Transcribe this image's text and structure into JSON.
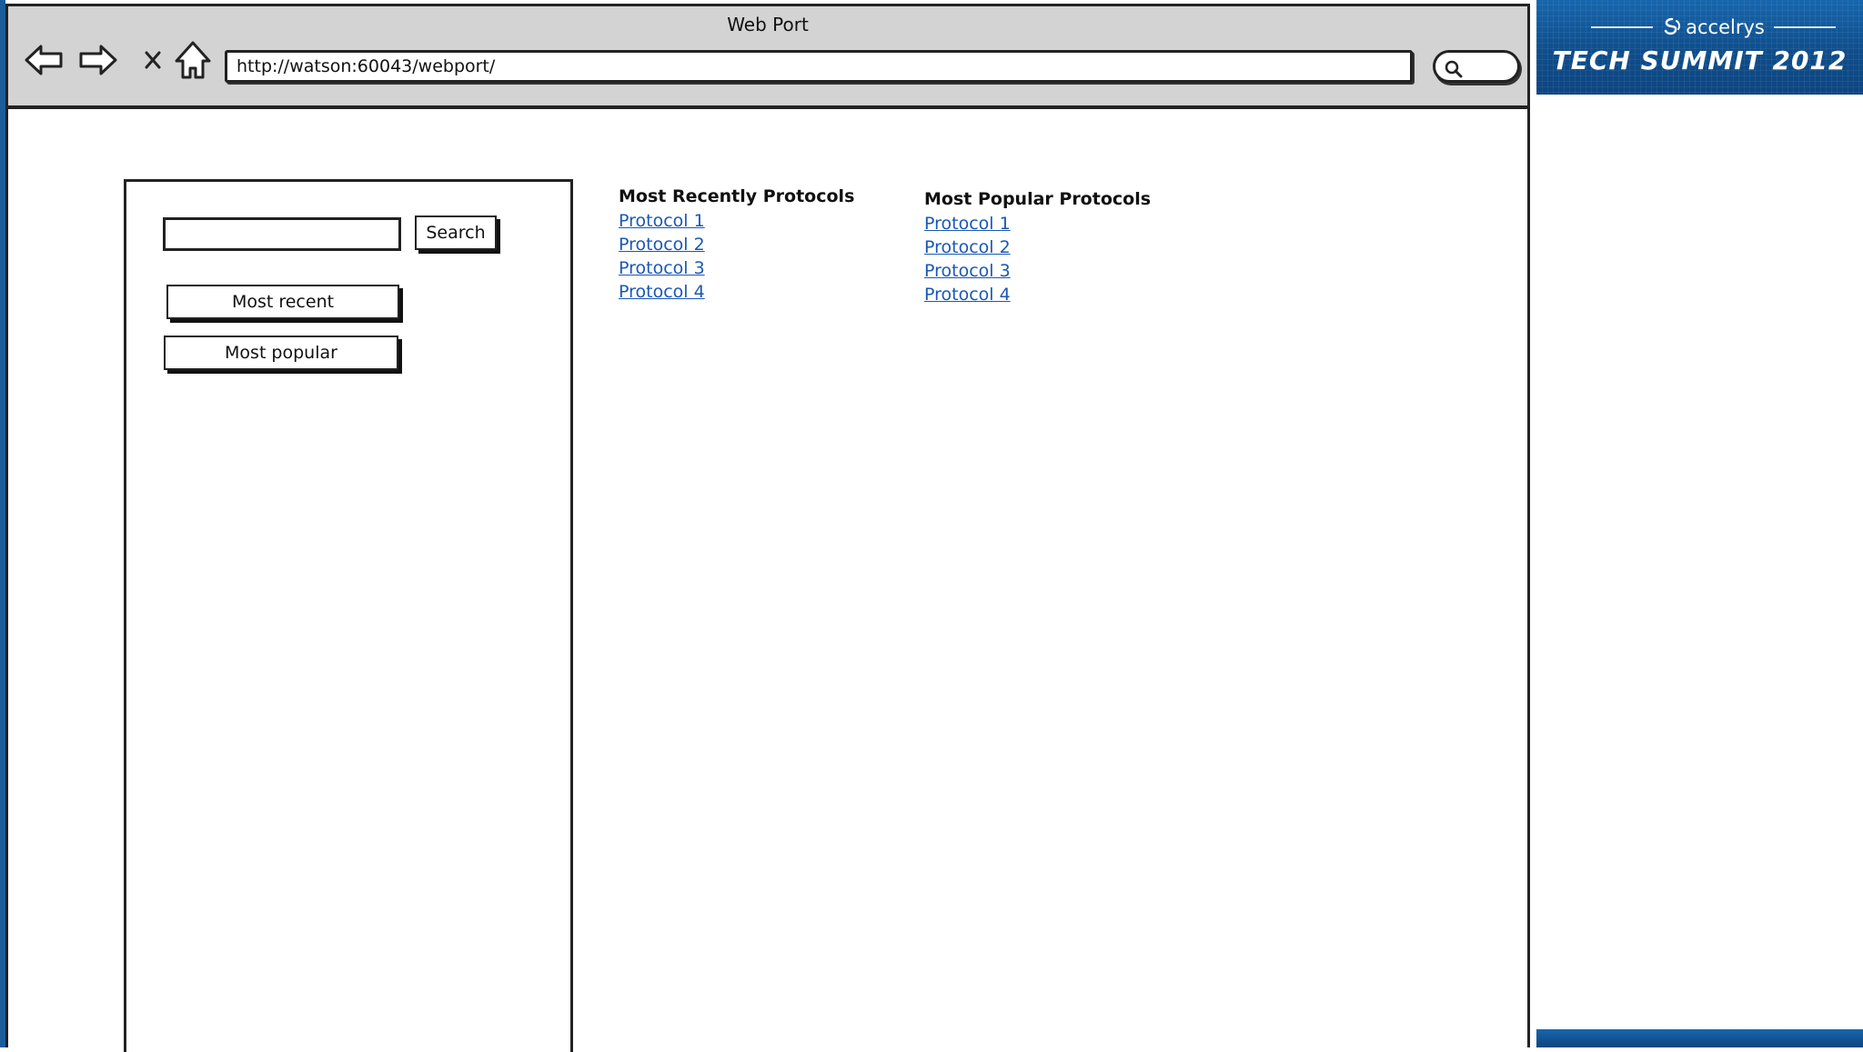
{
  "window": {
    "title": "Web Port",
    "url": "http://watson:60043/webport/"
  },
  "nav": {
    "back_icon": "back-arrow-icon",
    "forward_icon": "forward-arrow-icon",
    "stop_icon": "close-icon",
    "home_icon": "home-icon"
  },
  "sidebar": {
    "search_value": "",
    "search_label": "Search",
    "most_recent_label": "Most recent",
    "most_popular_label": "Most popular"
  },
  "recent": {
    "heading": "Most Recently Protocols",
    "items": [
      {
        "label": "Protocol 1"
      },
      {
        "label": "Protocol 2"
      },
      {
        "label": "Protocol 3"
      },
      {
        "label": "Protocol 4"
      }
    ]
  },
  "popular": {
    "heading": "Most Popular Protocols",
    "items": [
      {
        "label": "Protocol 1"
      },
      {
        "label": "Protocol 2"
      },
      {
        "label": "Protocol 3"
      },
      {
        "label": "Protocol 4"
      }
    ]
  },
  "branding": {
    "company": "accelrys",
    "event": "TECH SUMMIT 2012",
    "accent_color": "#1766ad"
  },
  "colors": {
    "link": "#1a58b5",
    "chrome": "#d3d3d3"
  }
}
